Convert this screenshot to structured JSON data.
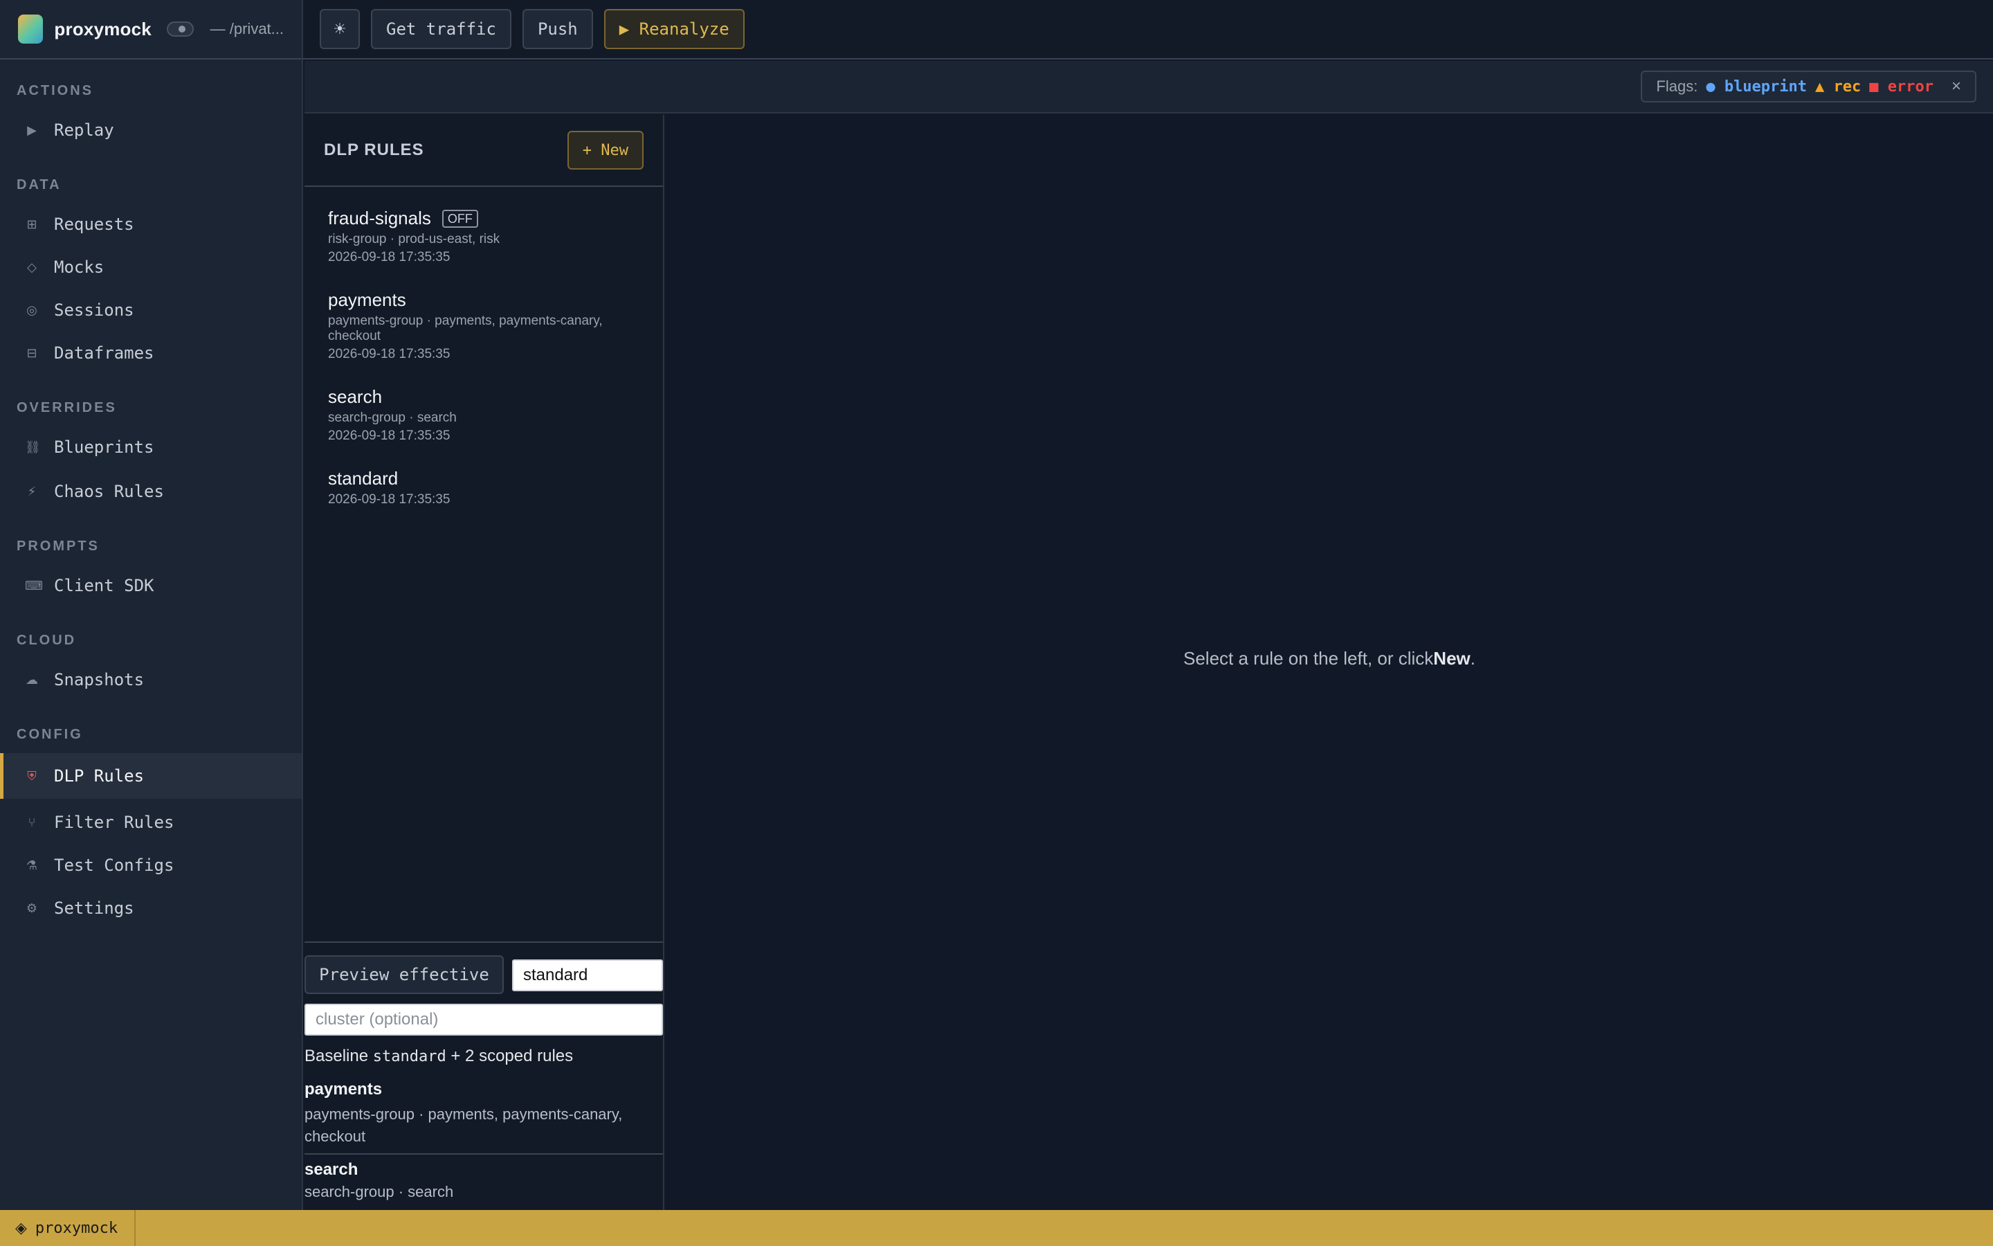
{
  "brand": {
    "name": "proxymock",
    "path": "— /privat..."
  },
  "topbar": {
    "theme_icon": "☀",
    "get_traffic": "Get traffic",
    "push": "Push",
    "reanalyze": "▶ Reanalyze"
  },
  "flags": {
    "label": "Flags:",
    "blueprint": "● blueprint",
    "rec": "▲ rec",
    "error": "■ error",
    "close": "×"
  },
  "sidebar": {
    "sections": {
      "actions": "ACTIONS",
      "data": "DATA",
      "overrides": "OVERRIDES",
      "prompts": "PROMPTS",
      "cloud": "CLOUD",
      "config": "CONFIG"
    },
    "items": {
      "replay": {
        "icon": "▶",
        "label": "Replay"
      },
      "requests": {
        "icon": "⊞",
        "label": "Requests"
      },
      "mocks": {
        "icon": "◇",
        "label": "Mocks"
      },
      "sessions": {
        "icon": "◎",
        "label": "Sessions"
      },
      "dataframes": {
        "icon": "⊟",
        "label": "Dataframes"
      },
      "blueprints": {
        "icon": "⛓",
        "label": "Blueprints"
      },
      "chaos": {
        "icon": "⚡",
        "label": "Chaos Rules"
      },
      "client_sdk": {
        "icon": "⌨",
        "label": "Client SDK"
      },
      "snapshots": {
        "icon": "☁",
        "label": "Snapshots"
      },
      "dlp": {
        "icon": "⛨",
        "label": "DLP Rules"
      },
      "filter": {
        "icon": "⑂",
        "label": "Filter Rules"
      },
      "test_configs": {
        "icon": "⚗",
        "label": "Test Configs"
      },
      "settings": {
        "icon": "⚙",
        "label": "Settings"
      }
    }
  },
  "rules_panel": {
    "title": "DLP RULES",
    "new_label": "+ New",
    "rules": [
      {
        "name": "fraud-signals",
        "badge": "OFF",
        "meta": "risk-group · prod-us-east, risk",
        "date": "2026-09-18 17:35:35"
      },
      {
        "name": "payments",
        "meta": "payments-group · payments, payments-canary, checkout",
        "date": "2026-09-18 17:35:35"
      },
      {
        "name": "search",
        "meta": "search-group · search",
        "date": "2026-09-18 17:35:35"
      },
      {
        "name": "standard",
        "date": "2026-09-18 17:35:35"
      }
    ]
  },
  "preview": {
    "button": "Preview effective",
    "rule_value": "standard",
    "cluster_placeholder": "cluster (optional)",
    "baseline_prefix": "Baseline ",
    "baseline_code": "standard",
    "baseline_suffix": " + 2 scoped rules",
    "scoped": [
      {
        "name": "payments",
        "meta": "payments-group · payments, payments-canary, checkout"
      },
      {
        "name": "search",
        "meta": "search-group · search"
      }
    ]
  },
  "main": {
    "empty_prefix": "Select a rule on the left, or click",
    "empty_bold": "New",
    "empty_suffix": "."
  },
  "statusbar": {
    "icon": "◈",
    "label": "proxymock"
  },
  "colors": {
    "accent": "#d4a843",
    "blueprint": "#60a5fa",
    "rec": "#f5a524",
    "error": "#ef4444",
    "statusbar": "#c9a443"
  }
}
